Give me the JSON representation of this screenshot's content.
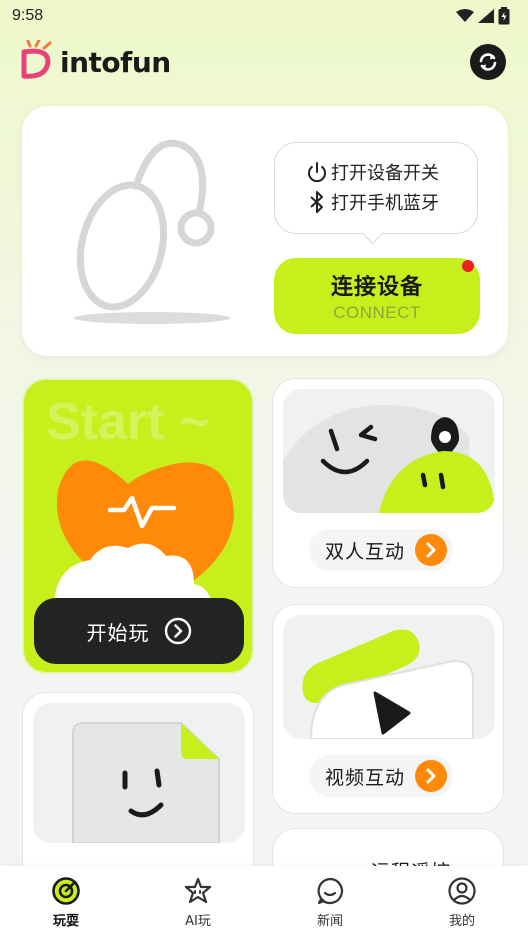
{
  "status": {
    "time": "9:58"
  },
  "brand": {
    "name": "intofun"
  },
  "device": {
    "tips": [
      {
        "icon": "power-icon",
        "text": "打开设备开关"
      },
      {
        "icon": "bluetooth-icon",
        "text": "打开手机蓝牙"
      }
    ],
    "connect_label": "连接设备",
    "connect_sub": "CONNECT"
  },
  "start": {
    "watermark": "Start ~",
    "button_label": "开始玩"
  },
  "cards": {
    "duo": "双人互动",
    "video": "视频互动",
    "remote_partial": "远程遥控"
  },
  "tabs": [
    {
      "icon": "play-target-icon",
      "label": "玩耍",
      "active": true
    },
    {
      "icon": "ai-star-icon",
      "label": "AI玩"
    },
    {
      "icon": "chat-bubble-icon",
      "label": "新闻"
    },
    {
      "icon": "profile-icon",
      "label": "我的"
    }
  ],
  "colors": {
    "accent": "#c6ef1c",
    "orange": "#ff8a0a",
    "dark": "#232323",
    "notify": "#f01e1e"
  }
}
